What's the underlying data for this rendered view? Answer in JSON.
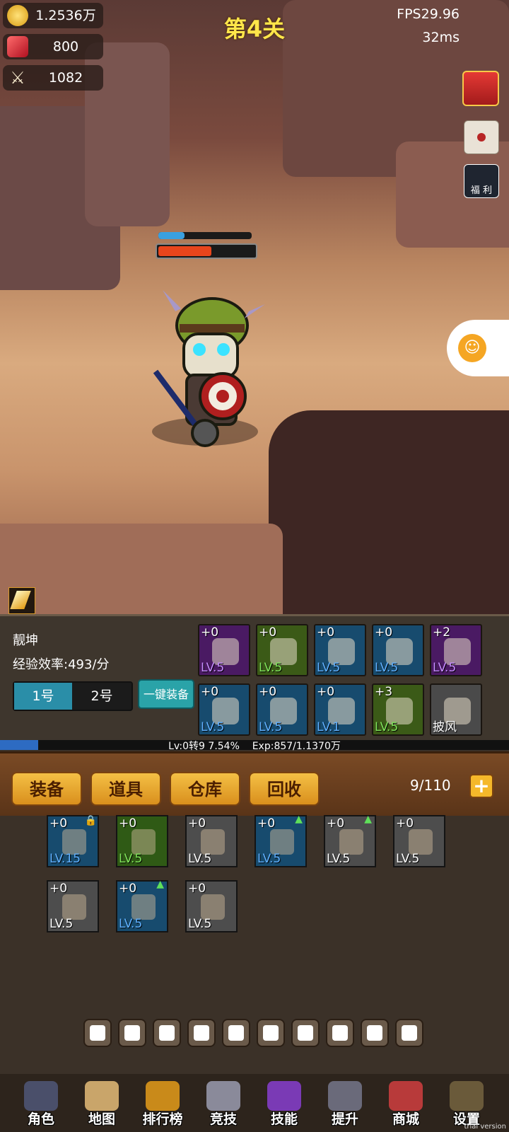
{
  "resources": {
    "gold": "1.2536万",
    "gems": "800",
    "power": "1082"
  },
  "stage_title": "第4关",
  "fps": "FPS29.96",
  "latency": "32ms",
  "side_icons": {
    "gift": "gift-icon",
    "mail": "mail-icon",
    "welfare_label": "福 利"
  },
  "enemy_hp_percent": 0.55,
  "enemy_mana_percent": 0.28,
  "character": {
    "name": "靓坤",
    "exp_rate": "经验效率:493/分",
    "preset_1": "1号",
    "preset_2": "2号",
    "equip_all": "一键装备"
  },
  "equip_slots": [
    {
      "plus": "+0",
      "lv": "LV.5",
      "bg": "#4a1a63",
      "lvcolor": "#c58cff"
    },
    {
      "plus": "+0",
      "lv": "LV.5",
      "bg": "#3b5a17",
      "lvcolor": "#7fe35a"
    },
    {
      "plus": "+0",
      "lv": "LV.5",
      "bg": "#174b6e",
      "lvcolor": "#5fb0ff"
    },
    {
      "plus": "+0",
      "lv": "LV.5",
      "bg": "#174b6e",
      "lvcolor": "#5fb0ff"
    },
    {
      "plus": "+2",
      "lv": "LV.5",
      "bg": "#4a1a63",
      "lvcolor": "#c58cff"
    },
    {
      "plus": "+0",
      "lv": "LV.5",
      "bg": "#174b6e",
      "lvcolor": "#5fb0ff"
    },
    {
      "plus": "+0",
      "lv": "LV.5",
      "bg": "#174b6e",
      "lvcolor": "#5fb0ff"
    },
    {
      "plus": "+0",
      "lv": "LV.1",
      "bg": "#174b6e",
      "lvcolor": "#5fb0ff"
    },
    {
      "plus": "+3",
      "lv": "LV.5",
      "bg": "#3b5a17",
      "lvcolor": "#7fe35a"
    },
    {
      "plus": "",
      "lv": "披风",
      "bg": "#4a4a4a",
      "lvcolor": "#ffffff"
    }
  ],
  "level_bar": {
    "text": "Lv:0转9 7.54%",
    "exp": "Exp:857/1.1370万",
    "progress": 0.0754
  },
  "tabs": [
    "装备",
    "道具",
    "仓库",
    "回收"
  ],
  "capacity": "9/110",
  "inventory": [
    {
      "plus": "+0",
      "lv": "LV.15",
      "style": "blue",
      "lvcolor": "#5fb0ff",
      "lock": true,
      "up": false
    },
    {
      "plus": "+0",
      "lv": "LV.5",
      "style": "green",
      "lvcolor": "#7fe35a",
      "lock": false,
      "up": false
    },
    {
      "plus": "+0",
      "lv": "LV.5",
      "style": "gray",
      "lvcolor": "#ffffff",
      "lock": false,
      "up": false
    },
    {
      "plus": "+0",
      "lv": "LV.5",
      "style": "blue",
      "lvcolor": "#5fb0ff",
      "lock": false,
      "up": true
    },
    {
      "plus": "+0",
      "lv": "LV.5",
      "style": "gray",
      "lvcolor": "#ffffff",
      "lock": false,
      "up": true
    },
    {
      "plus": "+0",
      "lv": "LV.5",
      "style": "gray",
      "lvcolor": "#ffffff",
      "lock": false,
      "up": false
    },
    {
      "plus": "+0",
      "lv": "LV.5",
      "style": "gray",
      "lvcolor": "#ffffff",
      "lock": false,
      "up": false
    },
    {
      "plus": "+0",
      "lv": "LV.5",
      "style": "blue",
      "lvcolor": "#5fb0ff",
      "lock": false,
      "up": true
    },
    {
      "plus": "+0",
      "lv": "LV.5",
      "style": "gray",
      "lvcolor": "#ffffff",
      "lock": false,
      "up": false
    }
  ],
  "filters": [
    "helmet-filter-icon",
    "ring-filter-icon",
    "belt-filter-icon",
    "shoulder-filter-icon",
    "weapon-filter-icon",
    "shield-filter-icon",
    "armor-filter-icon",
    "boots-filter-icon",
    "gloves-filter-icon",
    "cape-filter-icon"
  ],
  "nav": [
    "角色",
    "地图",
    "排行榜",
    "竞技",
    "技能",
    "提升",
    "商城",
    "设置"
  ],
  "watermark": "trial version"
}
